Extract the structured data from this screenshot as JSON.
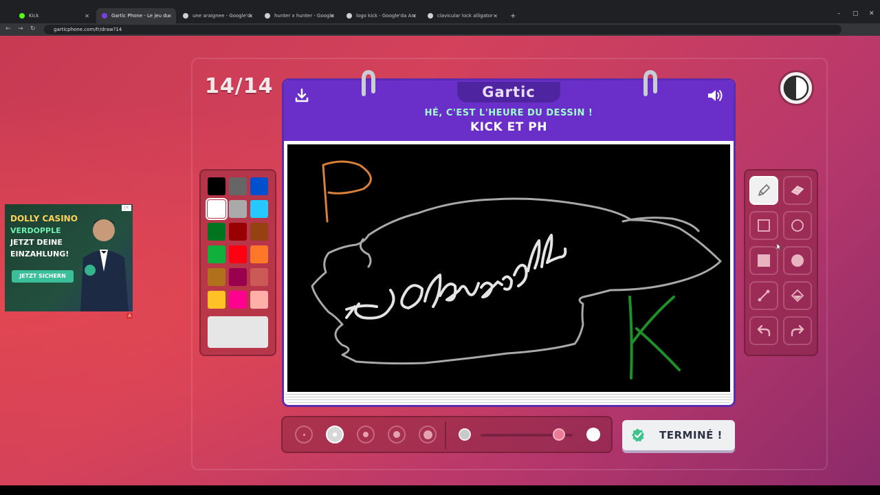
{
  "browser": {
    "tabs": [
      {
        "title": "Kick",
        "favicon_color": "#53fc18",
        "active": false
      },
      {
        "title": "Gartic Phone - Le jeu du téléph",
        "favicon_color": "#7b3fe4",
        "active": true
      },
      {
        "title": "une araignee - Google'da Ara",
        "favicon_color": "#cfcfcf",
        "active": false
      },
      {
        "title": "hunter x hunter - Google'da Ar",
        "favicon_color": "#cfcfcf",
        "active": false
      },
      {
        "title": "logo kick - Google'da Ara",
        "favicon_color": "#cfcfcf",
        "active": false
      },
      {
        "title": "clavicular lock alligator - Goog",
        "favicon_color": "#cfcfcf",
        "active": false
      }
    ],
    "new_tab": "+",
    "url": "garticphone.com/fr/draw?14",
    "window_controls": [
      "–",
      "▢",
      "✕"
    ]
  },
  "game": {
    "round": "14/14",
    "logo": "Gartic",
    "subtitle": "HÉ, C'EST L'HEURE DU DESSIN !",
    "prompt": "KICK ET PH",
    "done_label": "TERMINÉ !",
    "icons": {
      "download": "download-icon",
      "volume": "volume-icon",
      "contrast": "contrast-icon",
      "done": "check-icon"
    }
  },
  "palette": {
    "colors": [
      "#000000",
      "#666666",
      "#0050cd",
      "#ffffff",
      "#aaaaaa",
      "#26c9ff",
      "#017420",
      "#990000",
      "#964112",
      "#11b03c",
      "#ff0013",
      "#ff7829",
      "#b0701c",
      "#99004e",
      "#cb5a57",
      "#ffc126",
      "#ff008f",
      "#feafa8"
    ],
    "selected_index": 3,
    "current_color": "#e6e6e6"
  },
  "tools": [
    {
      "name": "pencil-tool",
      "icon": "pencil-icon",
      "selected": true
    },
    {
      "name": "eraser-tool",
      "icon": "eraser-icon",
      "selected": false
    },
    {
      "name": "rectangle-tool",
      "icon": "rectangle-outline-icon",
      "selected": false
    },
    {
      "name": "ellipse-tool",
      "icon": "circle-outline-icon",
      "selected": false
    },
    {
      "name": "filled-rectangle-tool",
      "icon": "filled-square-icon",
      "selected": false
    },
    {
      "name": "filled-ellipse-tool",
      "icon": "filled-circle-icon",
      "selected": false
    },
    {
      "name": "line-tool",
      "icon": "line-icon",
      "selected": false
    },
    {
      "name": "fill-tool",
      "icon": "paint-bucket-icon",
      "selected": false
    },
    {
      "name": "undo-tool",
      "icon": "undo-icon",
      "selected": false
    },
    {
      "name": "redo-tool",
      "icon": "redo-icon",
      "selected": false
    }
  ],
  "brush_sizes": {
    "count": 5,
    "selected_index": 1
  },
  "opacity": {
    "value": 0.85
  },
  "ad": {
    "title": "DOLLY CASINO",
    "line1": "VERDOPPLE",
    "line2": "JETZT DEINE",
    "line3": "EINZAHLUNG!",
    "cta": "JETZT SICHERN",
    "close": "i✕",
    "badge": "A"
  }
}
